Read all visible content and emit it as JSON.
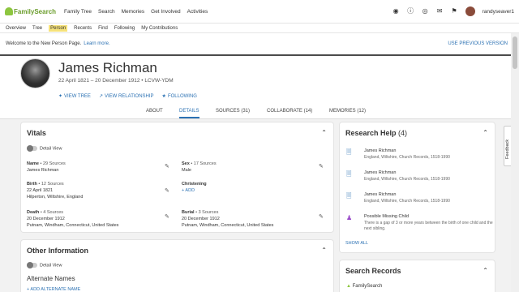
{
  "app": {
    "logo_text": "FamilySearch",
    "brand_color": "#6b9d2c",
    "link_color": "#2b71b3",
    "highlight_color": "#f6e27a"
  },
  "topnav": {
    "items": [
      "Family Tree",
      "Search",
      "Memories",
      "Get Involved",
      "Activities"
    ],
    "icons": [
      "location-icon",
      "help-icon",
      "globe-icon",
      "messages-icon",
      "notifications-icon"
    ],
    "username": "randyseaver1"
  },
  "subnav": {
    "items": [
      "Overview",
      "Tree",
      "Person",
      "Recents",
      "Find",
      "Following",
      "My Contributions"
    ],
    "active": "Person"
  },
  "banner": {
    "text": "Welcome to the New Person Page.",
    "link": "Learn more.",
    "right_link": "USE PREVIOUS VERSION"
  },
  "person": {
    "name": "James Richman",
    "dates": "22 April 1821 – 20 December 1912",
    "separator": "•",
    "pid": "LCVW-YDM",
    "actions": [
      {
        "label": "VIEW TREE",
        "icon": "tree-icon"
      },
      {
        "label": "VIEW RELATIONSHIP",
        "icon": "relationship-icon"
      },
      {
        "label": "FOLLOWING",
        "icon": "star-icon"
      }
    ]
  },
  "tabs": {
    "about": "ABOUT",
    "details": "DETAILS",
    "sources": "SOURCES (31)",
    "collaborate": "COLLABORATE (14)",
    "memories": "MEMORIES (12)",
    "active": "DETAILS"
  },
  "vitals": {
    "title": "Vitals",
    "detail_view": "Detail View",
    "name": {
      "label": "Name",
      "sources": "• 29 Sources",
      "value": "James Richman"
    },
    "sex": {
      "label": "Sex",
      "sources": "• 17 Sources",
      "value": "Male"
    },
    "birth": {
      "label": "Birth",
      "sources": "• 12 Sources",
      "date": "22 April 1821",
      "place": "Hilperton, Wiltshire, England"
    },
    "christening": {
      "label": "Christening",
      "add": "+ ADD"
    },
    "death": {
      "label": "Death",
      "sources": "• 4 Sources",
      "date": "20 December 1912",
      "place": "Putnam, Windham, Connecticut, United States"
    },
    "burial": {
      "label": "Burial",
      "sources": "• 3 Sources",
      "date": "20 December 1912",
      "place": "Putnam, Windham, Connecticut, United States"
    }
  },
  "other_info": {
    "title": "Other Information",
    "detail_view": "Detail View",
    "alternate_names": "Alternate Names",
    "add_alternate": "+ ADD ALTERNATE NAME"
  },
  "research_help": {
    "title": "Research Help",
    "count": "(4)",
    "items": [
      {
        "title": "James Richman",
        "sub": "England, Wiltshire, Church Records, 1518-1990",
        "icon": "record-hint-icon"
      },
      {
        "title": "James Richman",
        "sub": "England, Wiltshire, Church Records, 1518-1990",
        "icon": "record-hint-icon"
      },
      {
        "title": "James Richman",
        "sub": "England, Wiltshire, Church Records, 1518-1990",
        "icon": "record-hint-icon"
      },
      {
        "title": "Possible Missing Child",
        "sub": "There is a gap of 3 or more years between the birth of one child and the next sibling.",
        "icon": "missing-child-icon"
      }
    ],
    "show_all": "SHOW ALL"
  },
  "search_records": {
    "title": "Search Records",
    "first": "FamilySearch"
  },
  "feedback": "Feedback"
}
